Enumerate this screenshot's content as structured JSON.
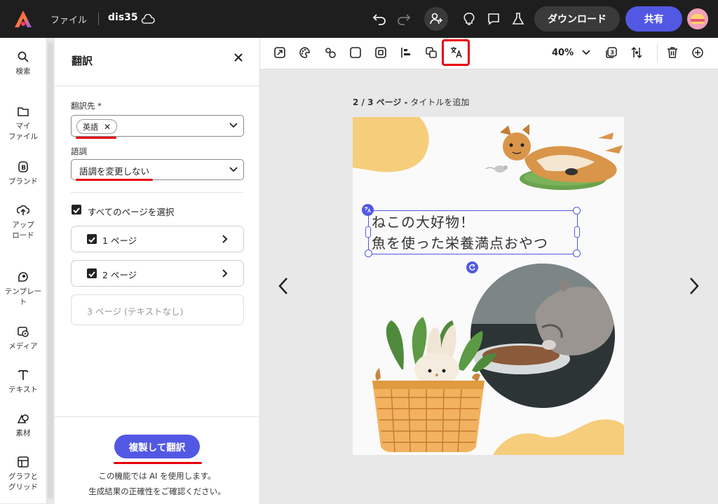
{
  "topbar": {
    "file_menu": "ファイル",
    "doc_name": "dis35",
    "download_label": "ダウンロード",
    "share_label": "共有",
    "icons": [
      "app-logo-icon",
      "cloud-icon",
      "undo-icon",
      "redo-icon",
      "invite-user-icon",
      "lightbulb-icon",
      "comment-icon",
      "flask-icon",
      "avatar"
    ]
  },
  "rail": {
    "items": [
      {
        "label": "検索",
        "icon": "search-icon"
      },
      {
        "label": "マイ\nファイル",
        "icon": "folder-icon"
      },
      {
        "label": "ブランド",
        "icon": "brand-icon"
      },
      {
        "label": "アップ\nロード",
        "icon": "upload-icon"
      },
      {
        "label": "テンプレー\nト",
        "icon": "template-icon"
      },
      {
        "label": "メディア",
        "icon": "media-icon"
      },
      {
        "label": "テキスト",
        "icon": "text-icon"
      },
      {
        "label": "素材",
        "icon": "elements-icon"
      },
      {
        "label": "グラフと\nグリッド",
        "icon": "chart-grid-icon"
      }
    ]
  },
  "panel": {
    "title": "翻訳",
    "target_label": "翻訳先 *",
    "target_chip": "英語",
    "tone_label": "語調",
    "tone_value": "語調を変更しない",
    "select_all_label": "すべてのページを選択",
    "pages": [
      {
        "label": "1 ページ",
        "checked": true,
        "enabled": true
      },
      {
        "label": "2 ページ",
        "checked": true,
        "enabled": true
      },
      {
        "label": "3 ページ (テキストなし)",
        "checked": false,
        "enabled": false
      }
    ],
    "cta_label": "複製して翻訳",
    "note_line1": "この機能では AI を使用します。",
    "note_line2": "生成結果の正確性をご確認ください。"
  },
  "toolbar": {
    "zoom": "40%",
    "icons": [
      "resize-icon",
      "palette-icon",
      "shapes-icon",
      "square-icon",
      "frame-icon",
      "align-icon",
      "arrange-icon",
      "translate-icon",
      "chevron-down-icon",
      "layers-icon",
      "position-icon",
      "trash-icon",
      "add-icon"
    ]
  },
  "canvas": {
    "page_indicator": "2 / 3 ページ -",
    "page_title_placeholder": "タイトルを追加",
    "text_line1": "ねこの大好物！",
    "text_line2": "魚を使った栄養満点おやつ"
  },
  "colors": {
    "accent": "#5258e4",
    "highlight": "#e8000b",
    "blob": "#f6cd7a",
    "topbar": "#1e1e1e"
  }
}
